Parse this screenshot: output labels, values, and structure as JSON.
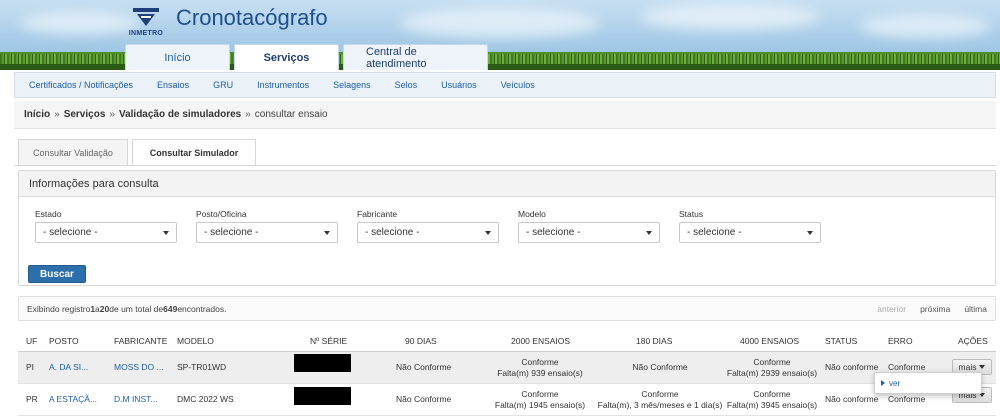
{
  "app": {
    "title": "Cronotacógrafo",
    "logo_text": "INMETRO"
  },
  "main_tabs": [
    {
      "label": "Início"
    },
    {
      "label": "Serviços"
    },
    {
      "label": "Central de atendimento"
    }
  ],
  "subnav": [
    {
      "label": "Certificados / Notificações"
    },
    {
      "label": "Ensaios"
    },
    {
      "label": "GRU"
    },
    {
      "label": "Instrumentos"
    },
    {
      "label": "Selagens"
    },
    {
      "label": "Selos"
    },
    {
      "label": "Usuários"
    },
    {
      "label": "Veículos"
    }
  ],
  "breadcrumb": {
    "home": "Início",
    "section": "Serviços",
    "page": "Validação de simuladores",
    "current": "consultar ensaio",
    "separator": "»"
  },
  "section_tabs": [
    {
      "label": "Consultar Validação"
    },
    {
      "label": "Consultar Simulador"
    }
  ],
  "filters": {
    "title": "Informações para consulta",
    "fields": [
      {
        "label": "Estado",
        "value": "- selecione -"
      },
      {
        "label": "Posto/Oficina",
        "value": "- selecione -"
      },
      {
        "label": "Fabricante",
        "value": "- selecione -"
      },
      {
        "label": "Modelo",
        "value": "- selecione -"
      },
      {
        "label": "Status",
        "value": "- selecione -"
      }
    ],
    "search_button": "Buscar"
  },
  "results": {
    "prefix": "Exibindo registro ",
    "from": "1",
    "mid1": " a ",
    "to": "20",
    "mid2": " de um total de ",
    "total": "649",
    "suffix": " encontrados.",
    "pager": {
      "prev": "anterior",
      "next": "próxima",
      "last": "última"
    }
  },
  "table": {
    "columns": [
      "UF",
      "POSTO",
      "FABRICANTE",
      "MODELO",
      "Nº SÉRIE",
      "90 DIAS",
      "2000 ENSAIOS",
      "180 DIAS",
      "4000 ENSAIOS",
      "STATUS",
      "ERRO",
      "AÇÕES"
    ],
    "rows": [
      {
        "uf": "PI",
        "posto": "A. DA SI...",
        "fabricante": "MOSS DO ...",
        "modelo": "SP-TR01WD",
        "dias90": "Não Conforme",
        "ensaios2000_a": "Conforme",
        "ensaios2000_b": "Falta(m) 939 ensaio(s)",
        "dias180_a": "Não Conforme",
        "dias180_b": "",
        "ensaios4000_a": "Conforme",
        "ensaios4000_b": "Falta(m) 2939 ensaio(s)",
        "status": "Não conforme",
        "erro": "Conforme",
        "action": "mais"
      },
      {
        "uf": "PR",
        "posto": "A ESTAÇÃ...",
        "fabricante": "D.M INST...",
        "modelo": "DMC 2022 WS",
        "dias90": "Não Conforme",
        "ensaios2000_a": "Conforme",
        "ensaios2000_b": "Falta(m) 1945 ensaio(s)",
        "dias180_a": "Conforme",
        "dias180_b": "Falta(m), 3 mês/meses e 1 dia(s)",
        "ensaios4000_a": "Conforme",
        "ensaios4000_b": "Falta(m) 3945 ensaio(s)",
        "status": "Não conforme",
        "erro": "Conforme",
        "action": "mais"
      }
    ]
  },
  "dropdown_menu": {
    "item": "ver"
  },
  "colors": {
    "accent": "#1f5fa8",
    "button": "#2d6fab",
    "header_sky": "#a9cde8",
    "grass": "#4f8f2a"
  }
}
